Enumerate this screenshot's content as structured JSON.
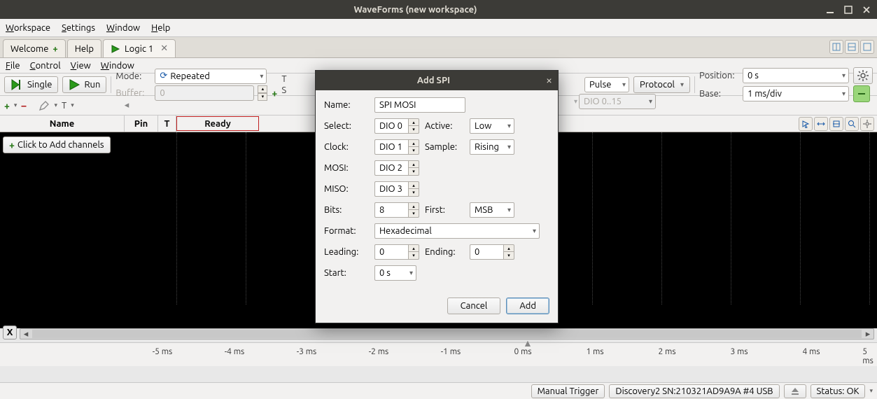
{
  "window": {
    "title": "WaveForms (new workspace)"
  },
  "menubar": {
    "workspace": "Workspace",
    "settings": "Settings",
    "window": "Window",
    "help": "Help"
  },
  "tabs": {
    "welcome": "Welcome",
    "help": "Help",
    "logic": "Logic 1"
  },
  "submenu": {
    "file": "File",
    "control": "Control",
    "view": "View",
    "window": "Window"
  },
  "toolbar": {
    "single": "Single",
    "run": "Run",
    "mode_label": "Mode:",
    "mode_value": "Repeated",
    "buffer_label": "Buffer:",
    "buffer_value": "0",
    "trigger_label": "T",
    "source_label": "S",
    "pulse_value": "Pulse",
    "protocol": "Protocol",
    "dio_value": "DIO 0..15",
    "position_label": "Position:",
    "position_value": "0 s",
    "base_label": "Base:",
    "base_value": "1 ms/div"
  },
  "toolbar2": {
    "t_label": "T"
  },
  "channel_header": {
    "name": "Name",
    "pin": "Pin",
    "t": "T",
    "status": "Ready"
  },
  "addchannels": "Click to Add channels",
  "timeaxis": {
    "ticks": [
      "-5 ms",
      "-4 ms",
      "-3 ms",
      "-2 ms",
      "-1 ms",
      "0 ms",
      "1 ms",
      "2 ms",
      "3 ms",
      "4 ms",
      "5 ms"
    ]
  },
  "statusbar": {
    "trigger": "Manual Trigger",
    "device": "Discovery2 SN:210321AD9A9A #4 USB",
    "status": "Status: OK"
  },
  "dialog": {
    "title": "Add SPI",
    "name_label": "Name:",
    "name_value": "SPI MOSI",
    "select_label": "Select:",
    "select_value": "DIO 0",
    "active_label": "Active:",
    "active_value": "Low",
    "clock_label": "Clock:",
    "clock_value": "DIO 1",
    "sample_label": "Sample:",
    "sample_value": "Rising",
    "mosi_label": "MOSI:",
    "mosi_value": "DIO 2",
    "miso_label": "MISO:",
    "miso_value": "DIO 3",
    "bits_label": "Bits:",
    "bits_value": "8",
    "first_label": "First:",
    "first_value": "MSB",
    "format_label": "Format:",
    "format_value": "Hexadecimal",
    "leading_label": "Leading:",
    "leading_value": "0",
    "ending_label": "Ending:",
    "ending_value": "0",
    "start_label": "Start:",
    "start_value": "0 s",
    "cancel": "Cancel",
    "add": "Add"
  }
}
